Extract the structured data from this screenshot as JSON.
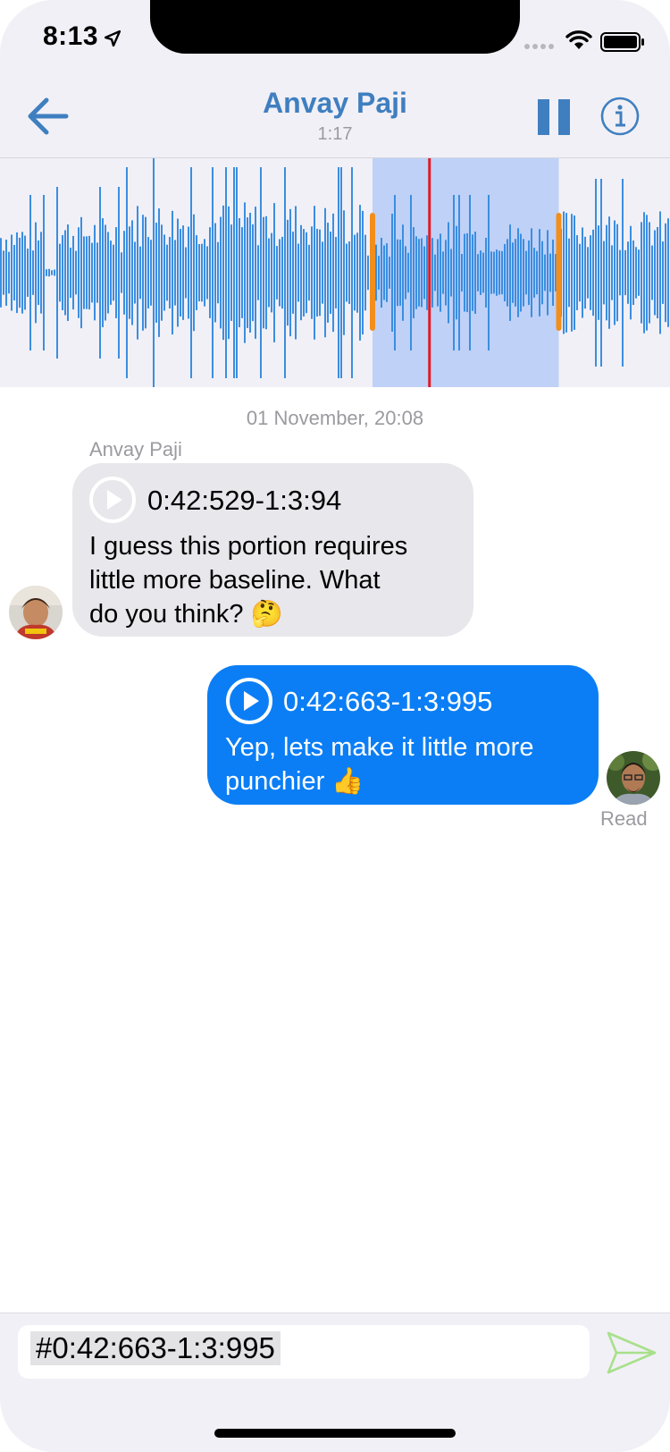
{
  "status_bar": {
    "time": "8:13"
  },
  "nav": {
    "title": "Anvay Paji",
    "subtitle": "1:17"
  },
  "waveform": {
    "selection_start": 0.556,
    "selection_end": 0.834,
    "playhead": 0.641,
    "colors": {
      "wave": "#3b8ee0",
      "selection": "#bfd1f7",
      "playhead": "#e01b24",
      "handle": "#f28e1c"
    }
  },
  "chat": {
    "timestamp": "01 November, 20:08",
    "messages": [
      {
        "sender": "Anvay Paji",
        "clip": "0:42:529-1:3:94",
        "text_lines": [
          "I guess this portion requires",
          "little more baseline. What",
          "do you think? 🤔"
        ]
      },
      {
        "clip": "0:42:663-1:3:995",
        "text_lines": [
          "Yep, lets make it little more",
          "punchier 👍"
        ],
        "status": "Read"
      }
    ]
  },
  "composer": {
    "value": "#0:42:663-1:3:995"
  },
  "colors": {
    "accent": "#3f7fc0",
    "outgoing_bubble": "#0b7ef5",
    "incoming_bubble": "#e7e7ec",
    "send": "#a8e08a"
  }
}
